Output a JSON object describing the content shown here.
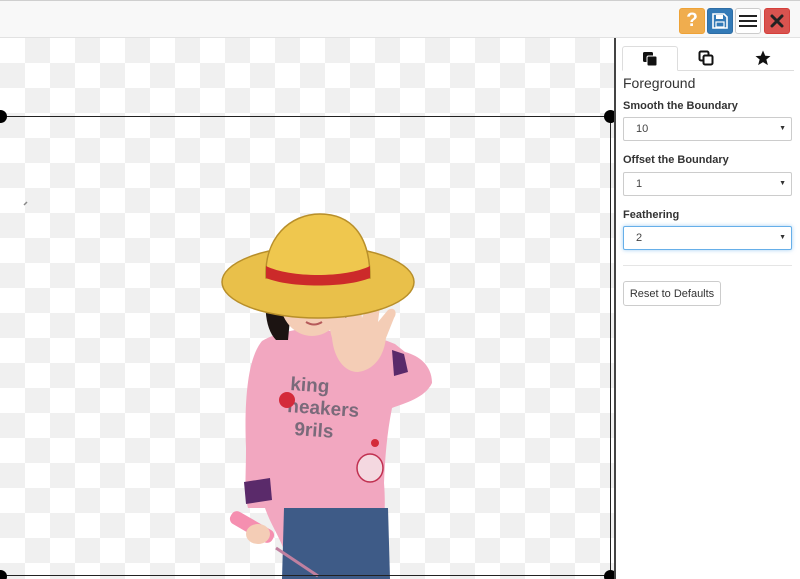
{
  "toolbar": {
    "help_label": "?",
    "buttons": [
      "help-icon",
      "save-icon",
      "menu-icon",
      "close-icon"
    ]
  },
  "canvas": {
    "image": "cutout of a child in a straw hat and pink shirt on a transparent background"
  },
  "panel": {
    "tabs": [
      {
        "icon": "foreground-layers-icon",
        "active": true
      },
      {
        "icon": "copy-layers-icon",
        "active": false
      },
      {
        "icon": "star-icon",
        "active": false
      }
    ],
    "title": "Foreground",
    "fields": [
      {
        "label": "Smooth the Boundary",
        "value": "10"
      },
      {
        "label": "Offset the Boundary",
        "value": "1"
      },
      {
        "label": "Feathering",
        "value": "2"
      }
    ],
    "reset_label": "Reset to Defaults"
  },
  "colors": {
    "help": "#f0ad4e",
    "save": "#337ab7",
    "close": "#d9534f",
    "shirt": "#f3a8c2",
    "hat": "#e9c04a"
  }
}
